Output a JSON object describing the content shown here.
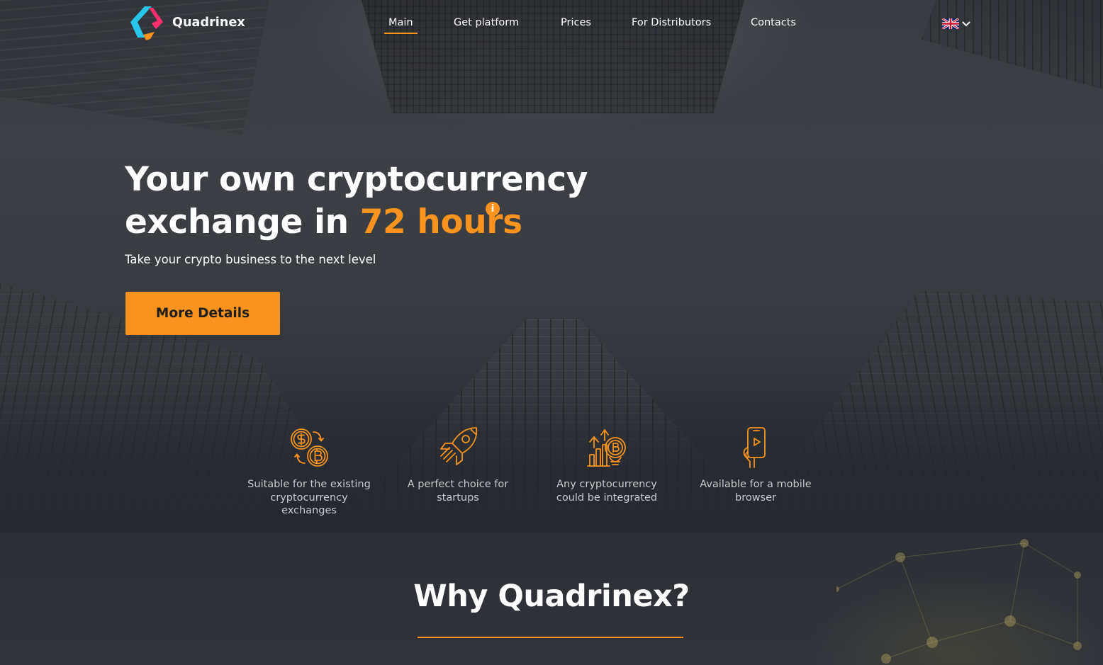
{
  "brand": {
    "name": "Quadrinex",
    "accent_color": "#f7931e",
    "logo_colors": [
      "#29c4ea",
      "#ff2f6e",
      "#f7931e"
    ]
  },
  "nav": {
    "items": [
      {
        "label": "Main",
        "active": true
      },
      {
        "label": "Get platform",
        "active": false
      },
      {
        "label": "Prices",
        "active": false
      },
      {
        "label": "For Distributors",
        "active": false
      },
      {
        "label": "Contacts",
        "active": false
      }
    ]
  },
  "language": {
    "icon": "uk-flag-icon",
    "dropdown_icon": "chevron-down-icon"
  },
  "hero": {
    "title_line1": "Your own cryptocurrency",
    "title_line2_prefix": "exchange in ",
    "title_highlight": "72 hours",
    "info_marker": "i",
    "subtitle": "Take your crypto business to the next level",
    "cta_label": "More Details"
  },
  "features": [
    {
      "icon": "coins-exchange-icon",
      "label": "Suitable for the existing cryptocurrency exchanges"
    },
    {
      "icon": "rocket-icon",
      "label": "A perfect choice for startups"
    },
    {
      "icon": "bitcoin-growth-icon",
      "label": "Any cryptocurrency could be integrated"
    },
    {
      "icon": "mobile-phone-icon",
      "label": "Available for a mobile browser"
    }
  ],
  "why": {
    "title": "Why Quadrinex?"
  }
}
